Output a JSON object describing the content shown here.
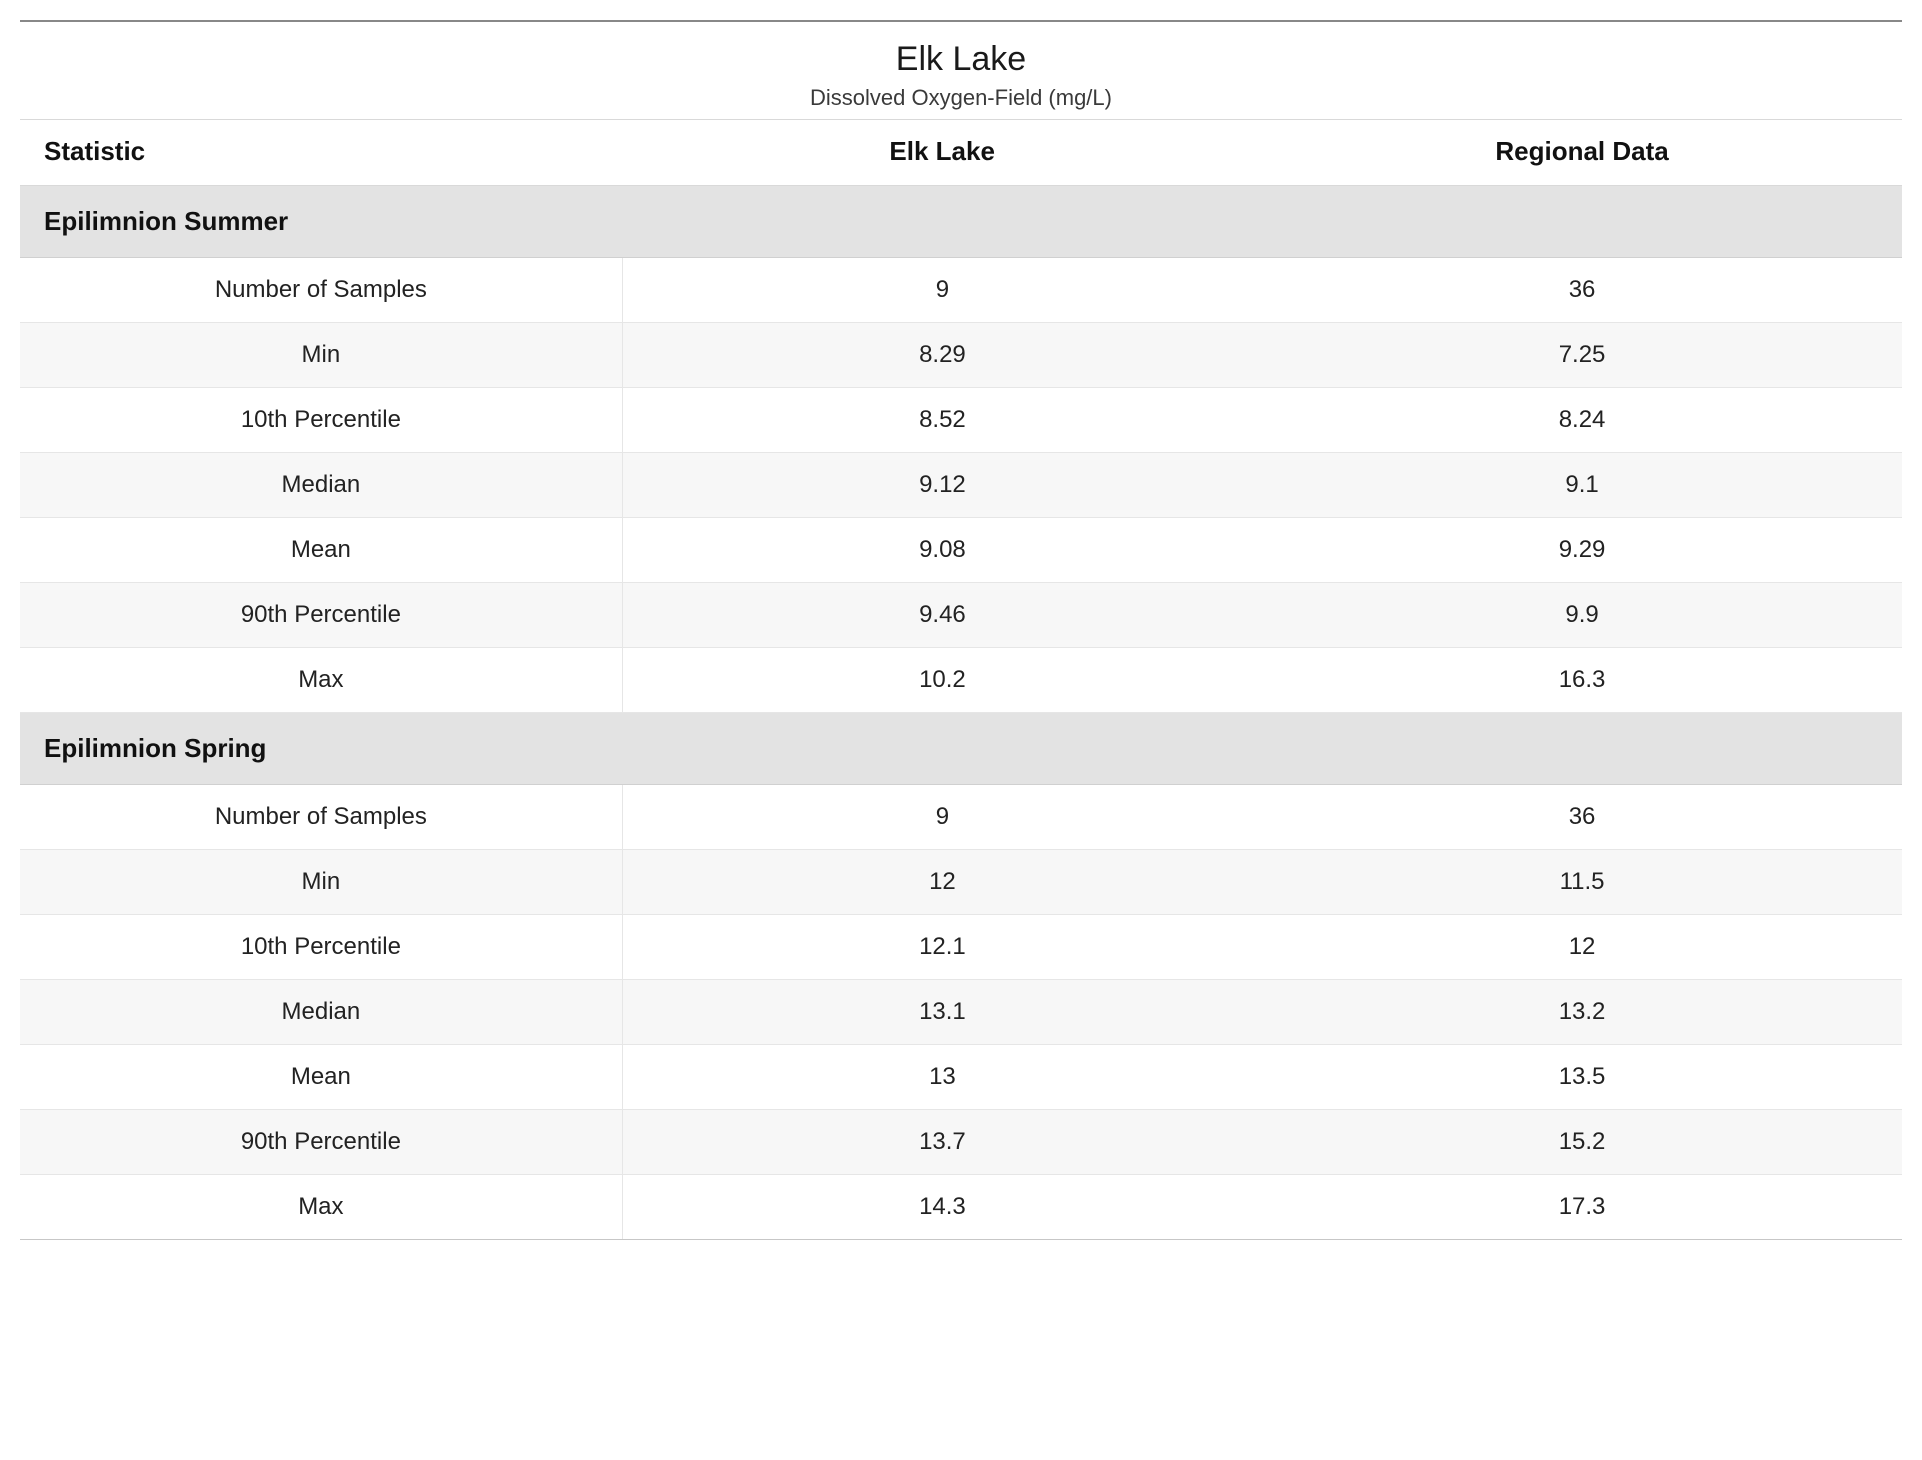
{
  "header": {
    "title": "Elk Lake",
    "subtitle": "Dissolved Oxygen-Field (mg/L)"
  },
  "columns": {
    "statistic": "Statistic",
    "lake": "Elk Lake",
    "regional": "Regional Data"
  },
  "sections": [
    {
      "name": "Epilimnion Summer",
      "rows": [
        {
          "stat": "Number of Samples",
          "lake": "9",
          "regional": "36"
        },
        {
          "stat": "Min",
          "lake": "8.29",
          "regional": "7.25"
        },
        {
          "stat": "10th Percentile",
          "lake": "8.52",
          "regional": "8.24"
        },
        {
          "stat": "Median",
          "lake": "9.12",
          "regional": "9.1"
        },
        {
          "stat": "Mean",
          "lake": "9.08",
          "regional": "9.29"
        },
        {
          "stat": "90th Percentile",
          "lake": "9.46",
          "regional": "9.9"
        },
        {
          "stat": "Max",
          "lake": "10.2",
          "regional": "16.3"
        }
      ]
    },
    {
      "name": "Epilimnion Spring",
      "rows": [
        {
          "stat": "Number of Samples",
          "lake": "9",
          "regional": "36"
        },
        {
          "stat": "Min",
          "lake": "12",
          "regional": "11.5"
        },
        {
          "stat": "10th Percentile",
          "lake": "12.1",
          "regional": "12"
        },
        {
          "stat": "Median",
          "lake": "13.1",
          "regional": "13.2"
        },
        {
          "stat": "Mean",
          "lake": "13",
          "regional": "13.5"
        },
        {
          "stat": "90th Percentile",
          "lake": "13.7",
          "regional": "15.2"
        },
        {
          "stat": "Max",
          "lake": "14.3",
          "regional": "17.3"
        }
      ]
    }
  ]
}
